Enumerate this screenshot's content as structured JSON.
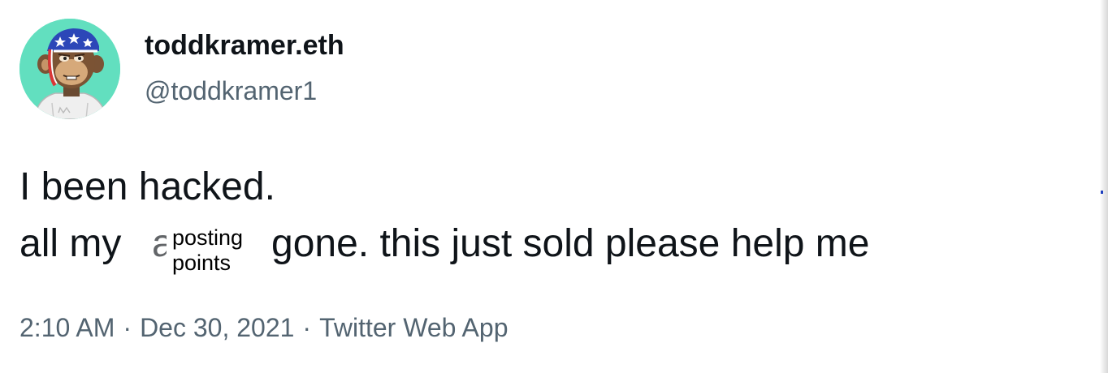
{
  "window": {
    "background": "#ffffff"
  },
  "tweet": {
    "avatar": {
      "icon": "bored-ape-avatar",
      "background_color": "#62dfbf"
    },
    "user": {
      "display_name": "toddkramer.eth",
      "handle": "@toddkramer1"
    },
    "text": {
      "line1": "I been hacked.",
      "line2_part1": "all my",
      "line2_part2": "gone. this just sold please help me",
      "partial_hidden_letter": "a"
    },
    "overlay_label": {
      "line1": "posting",
      "line2": "points"
    },
    "meta": {
      "time": "2:10 AM",
      "date": "Dec 30, 2021",
      "source": "Twitter Web App",
      "separator": "·"
    }
  },
  "colors": {
    "primary_text": "#0f1419",
    "secondary_text": "#536471",
    "avatar_bg": "#62dfbf",
    "right_edge_mark": "#1d3fbf"
  }
}
